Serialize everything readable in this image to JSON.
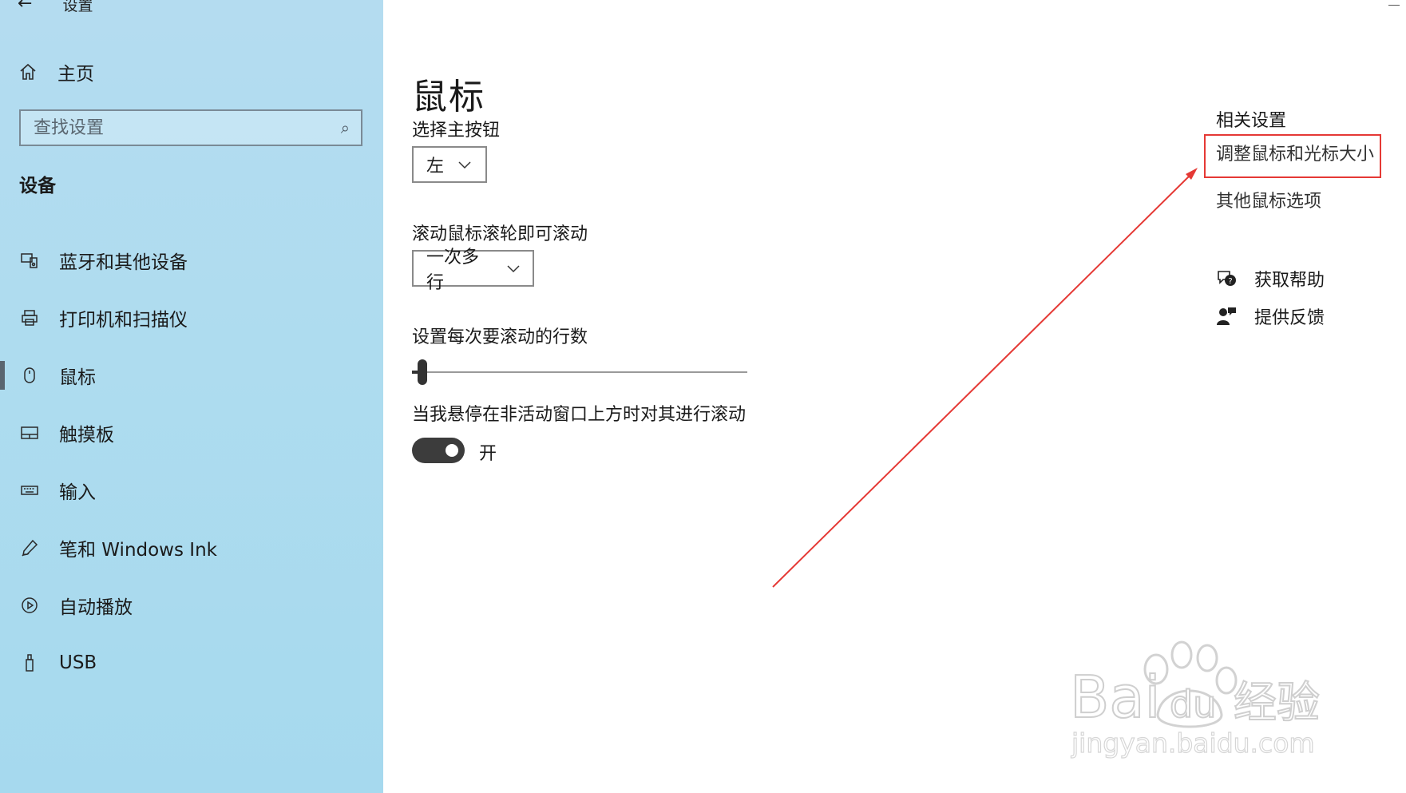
{
  "window": {
    "title": "设置"
  },
  "sidebar": {
    "home_label": "主页",
    "search": {
      "placeholder": "查找设置"
    },
    "section_title": "设备",
    "items": [
      {
        "label": "蓝牙和其他设备",
        "icon": "bluetooth-device-icon",
        "active": false
      },
      {
        "label": "打印机和扫描仪",
        "icon": "printer-icon",
        "active": false
      },
      {
        "label": "鼠标",
        "icon": "mouse-icon",
        "active": true
      },
      {
        "label": "触摸板",
        "icon": "touchpad-icon",
        "active": false
      },
      {
        "label": "输入",
        "icon": "keyboard-icon",
        "active": false
      },
      {
        "label": "笔和 Windows Ink",
        "icon": "pen-icon",
        "active": false
      },
      {
        "label": "自动播放",
        "icon": "autoplay-icon",
        "active": false
      },
      {
        "label": "USB",
        "icon": "usb-icon",
        "active": false
      }
    ]
  },
  "main": {
    "title": "鼠标",
    "primary_button": {
      "label": "选择主按钮",
      "value": "左"
    },
    "scroll_wheel": {
      "label": "滚动鼠标滚轮即可滚动",
      "value": "一次多行"
    },
    "lines_to_scroll": {
      "label": "设置每次要滚动的行数",
      "value_fraction": 0.03
    },
    "inactive_scroll": {
      "label": "当我悬停在非活动窗口上方时对其进行滚动",
      "state": "开",
      "on": true
    }
  },
  "related": {
    "title": "相关设置",
    "links": [
      "调整鼠标和光标大小",
      "其他鼠标选项"
    ],
    "help_label": "获取帮助",
    "feedback_label": "提供反馈"
  },
  "annotation": {
    "color": "#e53935"
  },
  "watermark": {
    "brand": "Bai",
    "brand_du": "du",
    "brand_cn": "经验",
    "url": "jingyan.baidu.com"
  }
}
